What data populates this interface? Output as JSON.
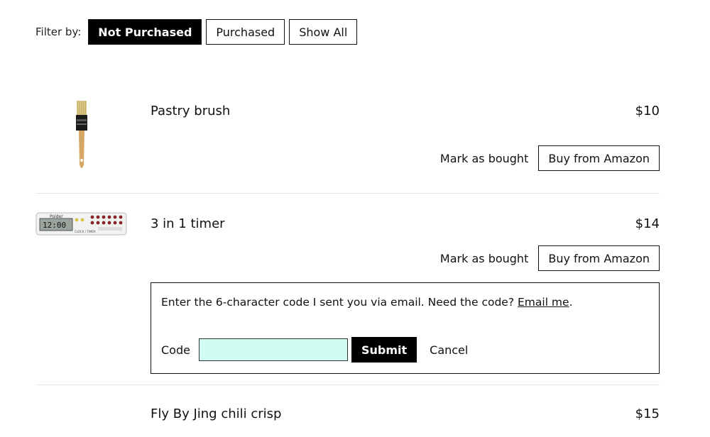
{
  "filter": {
    "label": "Filter by:",
    "options": [
      "Not Purchased",
      "Purchased",
      "Show All"
    ],
    "active": "Not Purchased"
  },
  "items": [
    {
      "name": "Pastry brush",
      "price": "$10",
      "mark_label": "Mark as bought",
      "buy_label": "Buy from Amazon"
    },
    {
      "name": "3 in 1 timer",
      "price": "$14",
      "mark_label": "Mark as bought",
      "buy_label": "Buy from Amazon"
    },
    {
      "name": "Fly By Jing chili crisp",
      "price": "$15"
    }
  ],
  "code_form": {
    "message": "Enter the 6-character code I sent you via email. Need the code?",
    "email_link": "Email me",
    "code_label": "Code",
    "code_value": "",
    "submit_label": "Submit",
    "cancel_label": "Cancel"
  },
  "timer_image_text": {
    "brand": "Polder",
    "display": "12:00",
    "caption": "CLOCK / TIMER"
  }
}
